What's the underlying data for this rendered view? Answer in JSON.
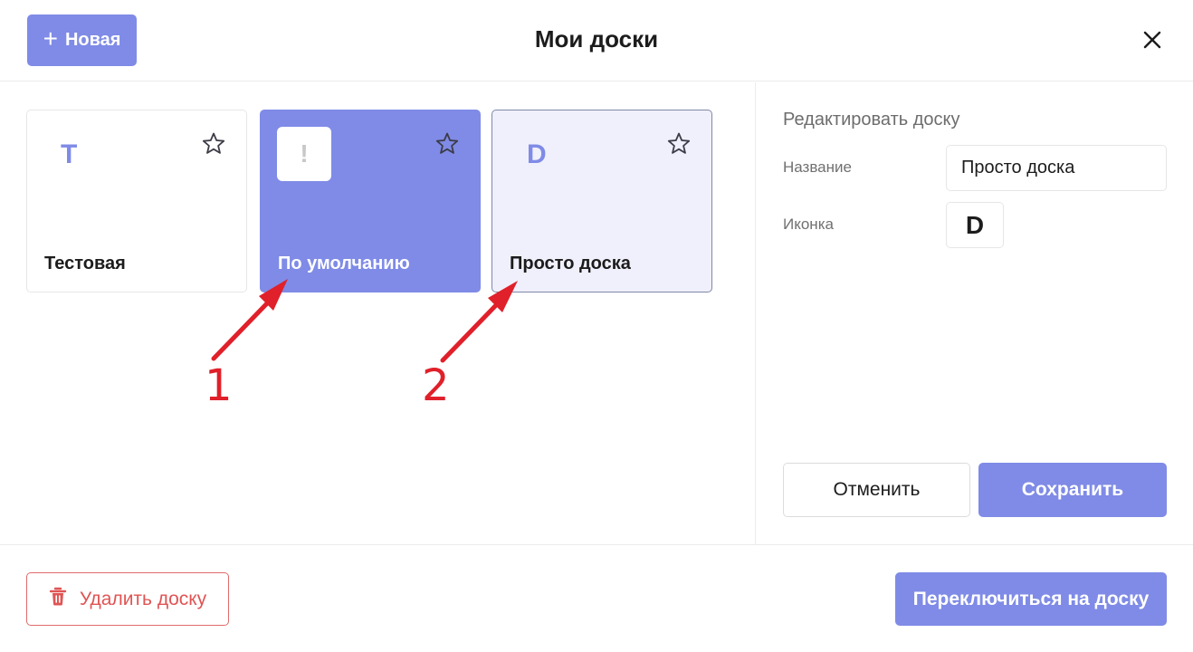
{
  "header": {
    "new_button_icon": "plus-icon",
    "new_button_label": "Новая",
    "title": "Мои доски",
    "close_icon": "close-icon"
  },
  "boards": [
    {
      "letter": "T",
      "name": "Тестовая",
      "icon": "star-icon",
      "state": "normal"
    },
    {
      "letter": "!",
      "name": "По умолчанию",
      "icon": "star-icon",
      "state": "active"
    },
    {
      "letter": "D",
      "name": "Просто доска",
      "icon": "star-icon",
      "state": "selected"
    }
  ],
  "annotations": {
    "arrow1_label": "1",
    "arrow2_label": "2",
    "color": "#e0202a"
  },
  "edit": {
    "title": "Редактировать доску",
    "name_label": "Название",
    "name_value": "Просто доска",
    "icon_label": "Иконка",
    "icon_value": "D",
    "cancel_label": "Отменить",
    "save_label": "Сохранить"
  },
  "footer": {
    "delete_icon": "trash-icon",
    "delete_label": "Удалить доску",
    "switch_label": "Переключиться на доску"
  },
  "colors": {
    "accent": "#7f8be6",
    "selected_bg": "#f0f0fc",
    "danger": "#e05454"
  }
}
